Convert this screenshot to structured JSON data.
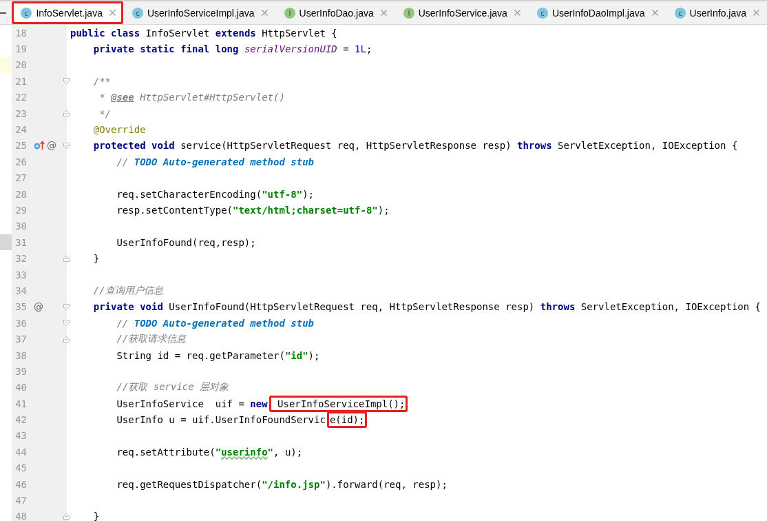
{
  "tabs": [
    {
      "label": "InfoServlet.java",
      "kind": "class",
      "icon_letter": "c",
      "selected": true,
      "boxed": true
    },
    {
      "label": "UserInfoServiceImpl.java",
      "kind": "class",
      "icon_letter": "c",
      "selected": false,
      "boxed": false
    },
    {
      "label": "UserInfoDao.java",
      "kind": "interface",
      "icon_letter": "I",
      "selected": false,
      "boxed": false
    },
    {
      "label": "UserInfoService.java",
      "kind": "interface",
      "icon_letter": "I",
      "selected": false,
      "boxed": false
    },
    {
      "label": "UserInfoDaoImpl.java",
      "kind": "class",
      "icon_letter": "c",
      "selected": false,
      "boxed": false
    },
    {
      "label": "UserInfo.java",
      "kind": "class",
      "icon_letter": "c",
      "selected": false,
      "boxed": false
    }
  ],
  "editor": {
    "lines": [
      {
        "number": "18",
        "current": false,
        "tokens": [
          {
            "kind": "kw",
            "text": "public class"
          },
          {
            "kind": "plain",
            "text": " InfoServlet "
          },
          {
            "kind": "kw",
            "text": "extends"
          },
          {
            "kind": "plain",
            "text": " HttpServlet {"
          }
        ]
      },
      {
        "number": "19",
        "current": false,
        "tokens": [
          {
            "kind": "kw",
            "text": "    private static final long "
          },
          {
            "kind": "field",
            "text": "serialVersionUID"
          },
          {
            "kind": "plain",
            "text": " = "
          },
          {
            "kind": "num",
            "text": "1L"
          },
          {
            "kind": "plain",
            "text": ";"
          }
        ]
      },
      {
        "number": "20",
        "current": true
      },
      {
        "number": "21",
        "current": false,
        "fold": {
          "kind": "start"
        },
        "tokens": [
          {
            "kind": "comment",
            "text": "    /**"
          }
        ]
      },
      {
        "number": "22",
        "current": false,
        "tokens": [
          {
            "kind": "comment",
            "text": "     * "
          },
          {
            "kind": "doctag",
            "text": "@see"
          },
          {
            "kind": "comment",
            "text": " HttpServlet#HttpServlet()"
          }
        ]
      },
      {
        "number": "23",
        "current": false,
        "fold": {
          "kind": "end"
        },
        "tokens": [
          {
            "kind": "comment",
            "text": "     */"
          }
        ]
      },
      {
        "number": "24",
        "current": false,
        "tokens": [
          {
            "kind": "annot",
            "text": "    @Override"
          }
        ]
      },
      {
        "number": "25",
        "current": false,
        "fold": {
          "kind": "start"
        },
        "gutter": [
          {
            "kind": "override"
          },
          {
            "kind": "at",
            "text": "@"
          }
        ],
        "tokens": [
          {
            "kind": "kw",
            "text": "    protected void"
          },
          {
            "kind": "plain",
            "text": " service(HttpServletRequest req, HttpServletResponse resp) "
          },
          {
            "kind": "kw",
            "text": "throws"
          },
          {
            "kind": "plain",
            "text": " ServletException, IOException {"
          }
        ]
      },
      {
        "number": "26",
        "current": false,
        "tokens": [
          {
            "kind": "comment",
            "text": "        // "
          },
          {
            "kind": "todo",
            "text": "TODO Auto-generated method stub"
          }
        ]
      },
      {
        "number": "27",
        "current": false
      },
      {
        "number": "28",
        "current": false,
        "tokens": [
          {
            "kind": "plain",
            "text": "        req.setCharacterEncoding("
          },
          {
            "kind": "str",
            "text": "\"utf-8\""
          },
          {
            "kind": "plain",
            "text": ");"
          }
        ]
      },
      {
        "number": "29",
        "current": false,
        "tokens": [
          {
            "kind": "plain",
            "text": "        resp.setContentType("
          },
          {
            "kind": "str",
            "text": "\"text/html;charset=utf-8\""
          },
          {
            "kind": "plain",
            "text": ");"
          }
        ]
      },
      {
        "number": "30",
        "current": false
      },
      {
        "number": "31",
        "current": false,
        "bookmark": true,
        "tokens": [
          {
            "kind": "plain",
            "text": "        UserInfoFound(req,resp);"
          }
        ]
      },
      {
        "number": "32",
        "current": false,
        "fold": {
          "kind": "end"
        },
        "tokens": [
          {
            "kind": "plain",
            "text": "    }"
          }
        ]
      },
      {
        "number": "33",
        "current": false
      },
      {
        "number": "34",
        "current": false,
        "tokens": [
          {
            "kind": "comment",
            "text": "    //查询用户信息"
          }
        ]
      },
      {
        "number": "35",
        "current": false,
        "fold": {
          "kind": "start"
        },
        "gutter": [
          {
            "kind": "at",
            "text": "@"
          }
        ],
        "tokens": [
          {
            "kind": "kw",
            "text": "    private void"
          },
          {
            "kind": "plain",
            "text": " UserInfoFound(HttpServletRequest req, HttpServletResponse resp) "
          },
          {
            "kind": "kw",
            "text": "throws"
          },
          {
            "kind": "plain",
            "text": " ServletException, IOException {"
          }
        ]
      },
      {
        "number": "36",
        "current": false,
        "fold": {
          "kind": "start"
        },
        "tokens": [
          {
            "kind": "comment",
            "text": "        // "
          },
          {
            "kind": "todo",
            "text": "TODO Auto-generated method stub"
          }
        ]
      },
      {
        "number": "37",
        "current": false,
        "fold": {
          "kind": "end"
        },
        "tokens": [
          {
            "kind": "comment",
            "text": "        //获取请求信息"
          }
        ]
      },
      {
        "number": "38",
        "current": false,
        "tokens": [
          {
            "kind": "plain",
            "text": "        String id = req.getParameter("
          },
          {
            "kind": "str",
            "text": "\"id\""
          },
          {
            "kind": "plain",
            "text": ");"
          }
        ]
      },
      {
        "number": "39",
        "current": false
      },
      {
        "number": "40",
        "current": false,
        "tokens": [
          {
            "kind": "comment",
            "text": "        //获取 service 层对象"
          }
        ]
      },
      {
        "number": "41",
        "current": false,
        "tokens": [
          {
            "kind": "plain",
            "text": "        UserInfoService  uif = "
          },
          {
            "kind": "kw",
            "text": "new"
          },
          {
            "kind": "plain",
            "text": " UserInfoServiceImpl();",
            "boxed": true
          }
        ]
      },
      {
        "number": "42",
        "current": false,
        "tokens": [
          {
            "kind": "plain",
            "text": "        UserInfo u = uif.UserInfoFoundServic"
          },
          {
            "kind": "plain",
            "text": "e(id);",
            "boxed": true
          }
        ]
      },
      {
        "number": "43",
        "current": false
      },
      {
        "number": "44",
        "current": false,
        "tokens": [
          {
            "kind": "plain",
            "text": "        req.setAttribute("
          },
          {
            "kind": "str",
            "text": "\""
          },
          {
            "kind": "typo",
            "text": "userinfo"
          },
          {
            "kind": "str",
            "text": "\""
          },
          {
            "kind": "plain",
            "text": ", u);"
          }
        ]
      },
      {
        "number": "45",
        "current": false
      },
      {
        "number": "46",
        "current": false,
        "tokens": [
          {
            "kind": "plain",
            "text": "        req.getRequestDispatcher("
          },
          {
            "kind": "str",
            "text": "\"/info.jsp\""
          },
          {
            "kind": "plain",
            "text": ").forward(req, resp);"
          }
        ]
      },
      {
        "number": "47",
        "current": false
      },
      {
        "number": "48",
        "current": false,
        "fold": {
          "kind": "end"
        },
        "tokens": [
          {
            "kind": "plain",
            "text": "    }"
          }
        ]
      }
    ]
  }
}
